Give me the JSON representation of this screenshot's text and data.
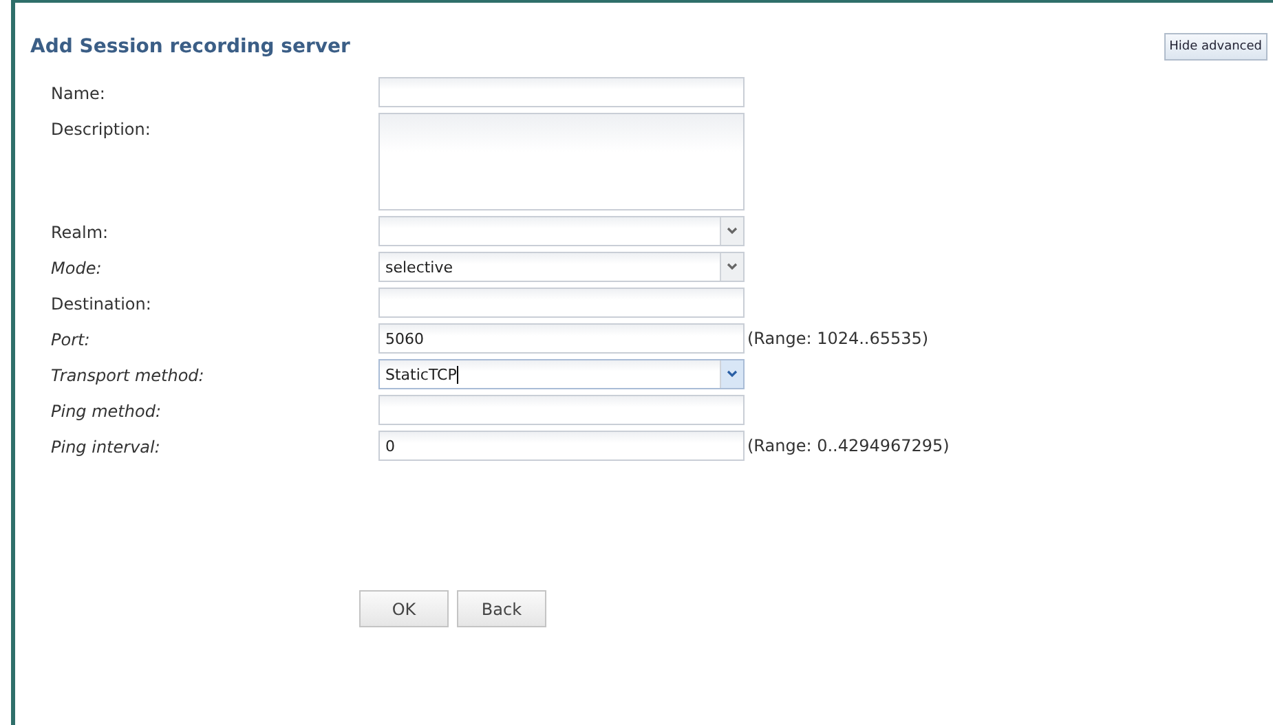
{
  "title": "Add Session recording server",
  "hide_advanced_button": "Hide advanced",
  "fields": [
    {
      "label": "Name:",
      "kind": "text",
      "advanced": false,
      "focused": false
    },
    {
      "label": "Description:",
      "kind": "textarea",
      "advanced": false,
      "focused": false
    },
    {
      "label": "Realm:",
      "kind": "select",
      "advanced": false,
      "focused": false
    },
    {
      "label": "Mode:",
      "kind": "select",
      "advanced": true,
      "focused": false,
      "value": "selective"
    },
    {
      "label": "Destination:",
      "kind": "text",
      "advanced": false,
      "focused": false
    },
    {
      "label": "Port:",
      "kind": "text",
      "advanced": true,
      "focused": false,
      "value": "5060",
      "hint": "(Range: 1024..65535)"
    },
    {
      "label": "Transport method:",
      "kind": "select",
      "advanced": true,
      "focused": true,
      "value": "StaticTCP"
    },
    {
      "label": "Ping method:",
      "kind": "text",
      "advanced": true,
      "focused": false
    },
    {
      "label": "Ping interval:",
      "kind": "text",
      "advanced": true,
      "focused": false,
      "value": "0",
      "hint": "(Range: 0..4294967295)"
    }
  ],
  "buttons": [
    "OK",
    "Back"
  ]
}
